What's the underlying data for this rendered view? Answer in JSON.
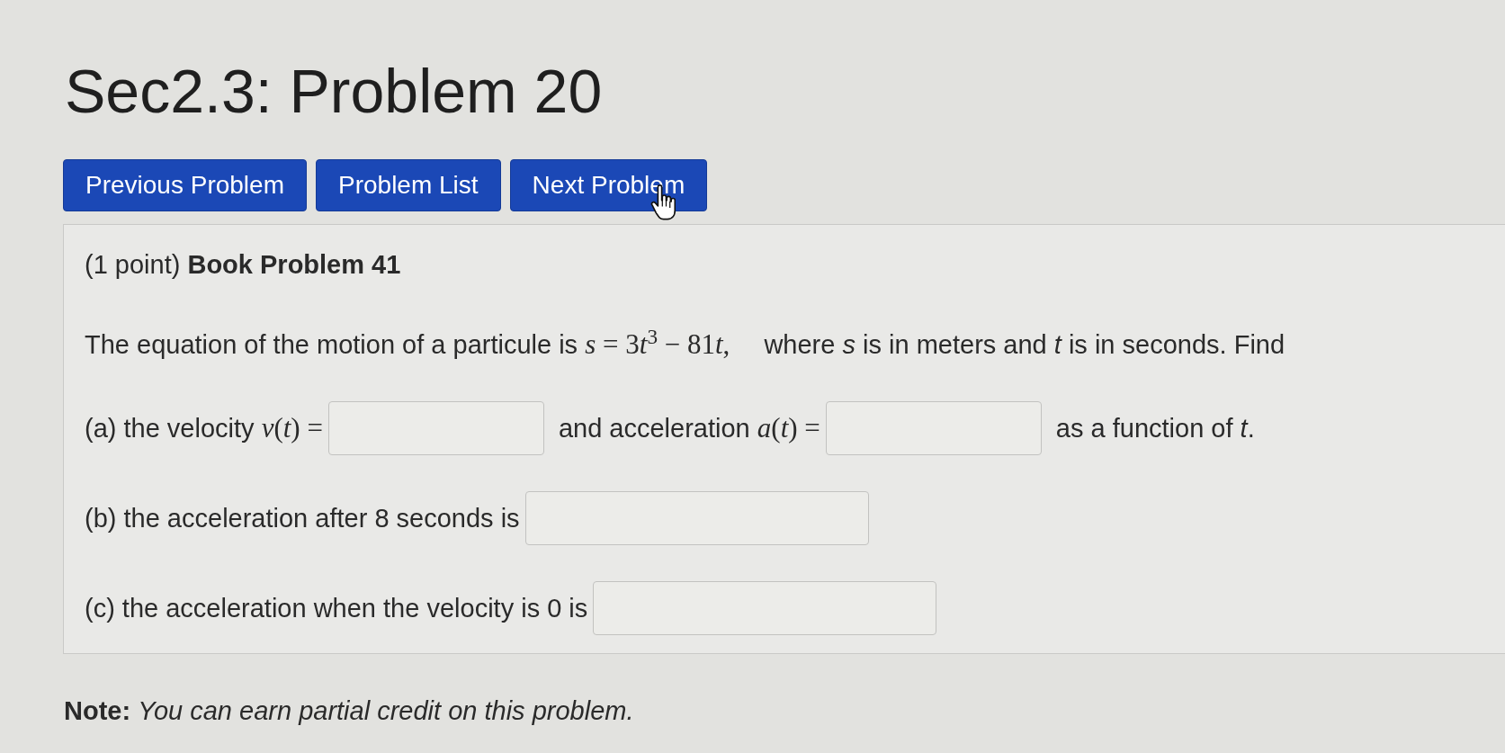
{
  "title": "Sec2.3: Problem 20",
  "nav_buttons": [
    {
      "label": "Previous Problem"
    },
    {
      "label": "Problem List"
    },
    {
      "label": "Next Problem"
    }
  ],
  "problem": {
    "heading": "(1 point) **Book Problem 41**",
    "statement": [
      {
        "kind": "prose",
        "text": "The equation of the motion of a particule is"
      },
      {
        "kind": "math",
        "text": "*s* = 3"
      },
      {
        "kind": "math",
        "text": "*t*$^{3}$ − 81"
      },
      {
        "kind": "math",
        "text": "*t*,"
      },
      {
        "kind": "prose",
        "text": "where *s* is in meters and *t* is in seconds. Find"
      }
    ],
    "parts": [
      {
        "items": [
          {
            "kind": "text",
            "runs": [
              {
                "kind": "prose",
                "text": "(a) the velocity"
              },
              {
                "kind": "math",
                "text": "*v*(*t*) ="
              }
            ]
          },
          {
            "kind": "answer"
          },
          {
            "kind": "text",
            "runs": [
              {
                "kind": "prose",
                "text": "and acceleration"
              },
              {
                "kind": "math",
                "text": "*a*(*t*) ="
              }
            ]
          },
          {
            "kind": "answer"
          },
          {
            "kind": "text",
            "runs": [
              {
                "kind": "prose",
                "text": "as a function of *t*."
              }
            ]
          }
        ]
      },
      {
        "items": [
          {
            "kind": "text",
            "runs": [
              {
                "kind": "prose",
                "text": "(b) the acceleration after 8 seconds is"
              }
            ]
          },
          {
            "kind": "answer"
          }
        ]
      },
      {
        "items": [
          {
            "kind": "text",
            "runs": [
              {
                "kind": "prose",
                "text": "(c) the acceleration when the velocity is 0 is"
              }
            ]
          },
          {
            "kind": "answer"
          }
        ]
      }
    ]
  },
  "note": "**Note:** *You can earn partial credit on this problem.*"
}
